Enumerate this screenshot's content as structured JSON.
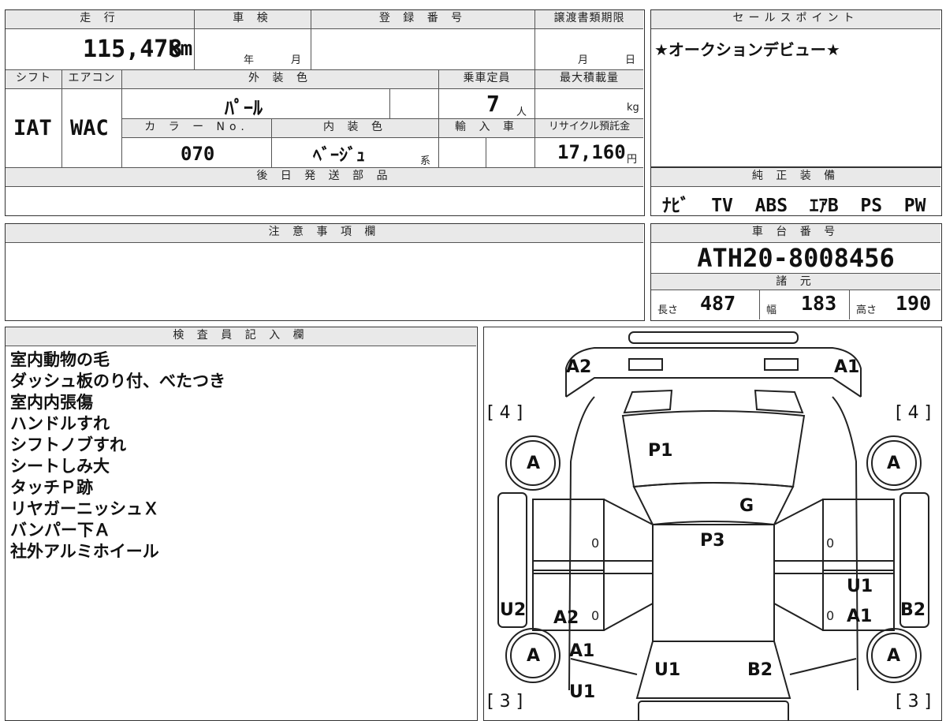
{
  "top_form": {
    "mileage": {
      "label": "走 行",
      "value": "115,478",
      "unit": "km"
    },
    "inspection": {
      "label": "車 検",
      "year_unit": "年",
      "month_unit": "月"
    },
    "registration": {
      "label": "登 録 番 号"
    },
    "transfer_deadline": {
      "label": "譲渡書類期限",
      "month_unit": "月",
      "day_unit": "日"
    },
    "shift": {
      "label": "シフト",
      "value": "IAT"
    },
    "aircon": {
      "label": "エアコン",
      "value": "WAC"
    },
    "exterior_color": {
      "label": "外 装 色",
      "value": "ﾊﾟｰﾙ"
    },
    "capacity": {
      "label": "乗車定員",
      "value": "7",
      "unit": "人"
    },
    "max_load": {
      "label": "最大積載量",
      "unit": "kg"
    },
    "color_no": {
      "label": "カ ラ ー No.",
      "value": "070"
    },
    "interior_color": {
      "label": "内 装 色",
      "value": "ﾍﾞｰｼﾞｭ",
      "suffix": "系"
    },
    "import": {
      "label": "輸 入 車"
    },
    "recycle_fee": {
      "label": "リサイクル預託金",
      "value": "17,160",
      "unit": "円"
    },
    "later_parts": {
      "label": "後 日 発 送 部 品"
    }
  },
  "sales_point": {
    "label": "セールスポイント",
    "text": "★オークションデビュー★"
  },
  "genuine_equipment": {
    "label": "純 正 装 備",
    "text": "ﾅﾋﾞ  TV  ABS  ｴｱB  PS  PW"
  },
  "notes": {
    "label": "注 意 事 項 欄"
  },
  "chassis": {
    "label": "車 台 番 号",
    "value": "ATH20-8008456"
  },
  "specs": {
    "label": "諸 元",
    "length": {
      "label": "長さ",
      "value": "487"
    },
    "width": {
      "label": "幅",
      "value": "183"
    },
    "height": {
      "label": "高さ",
      "value": "190"
    }
  },
  "inspector": {
    "label": "検 査 員 記 入 欄",
    "remarks": [
      "室内動物の毛",
      "ダッシュ板のり付、べたつき",
      "室内内張傷",
      "ハンドルすれ",
      "シフトノブすれ",
      "シートしみ大",
      "タッチＰ跡",
      "リヤガーニッシュＸ",
      "バンパー下Ａ",
      "社外アルミホイール"
    ]
  },
  "diagram": {
    "front_left": "A2",
    "front_right": "A1",
    "bracket_top_left": "[ 4 ]",
    "bracket_top_right": "[ 4 ]",
    "bracket_bottom_left": "[ 3 ]",
    "bracket_bottom_right": "[ 3 ]",
    "wheel_fl": "A",
    "wheel_fr": "A",
    "wheel_rl": "A",
    "wheel_rr": "A",
    "hood": "P1",
    "windshield": "G",
    "roof": "P3",
    "left_side": "U2",
    "left_rear_door": "A2",
    "left_rear_fender": "A1",
    "left_rear_bottom": "U1",
    "right_side": "B2",
    "right_rear_door": "U1",
    "right_rear_fender": "A1",
    "rear_left": "U1",
    "rear_right": "B2",
    "zero_mark": "0"
  }
}
